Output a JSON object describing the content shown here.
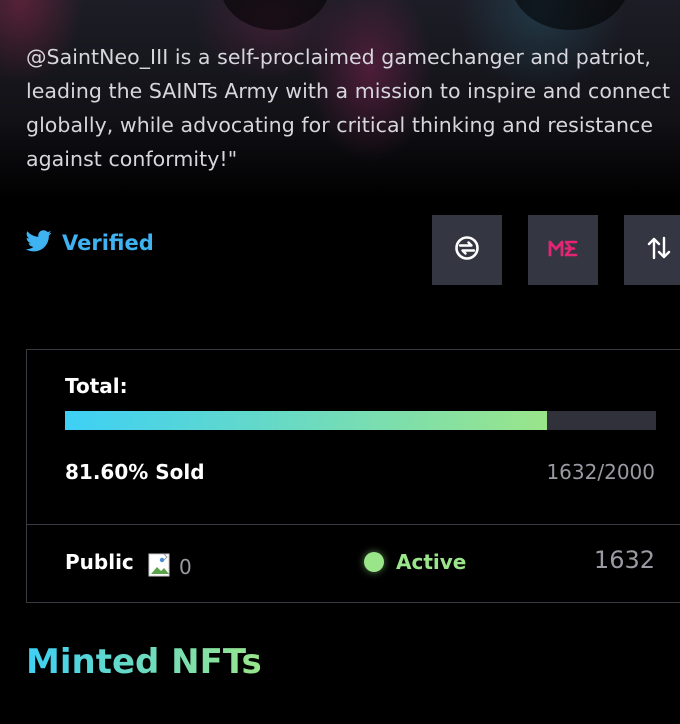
{
  "profile": {
    "description": "@SaintNeo_III is a self-proclaimed gamechanger and patriot, leading the SAINTs Army with a mission to inspire and connect globally, while advocating for critical thinking and resistance against conformity!\"",
    "verified_label": "Verified",
    "verified_icon": "twitter-bird-icon",
    "twitter_color": "#3fb2f2"
  },
  "actions": [
    {
      "icon": "sniper-icon"
    },
    {
      "icon": "magic-eden-icon",
      "color": "#e42575"
    },
    {
      "icon": "swap-arrows-icon"
    }
  ],
  "stats": {
    "total_label": "Total:",
    "progress_fraction": 0.816,
    "sold_label": "81.60% Sold",
    "sold_count": "1632/2000",
    "phase_label": "Public",
    "price_value": "0",
    "status_label": "Active",
    "minted_count": "1632",
    "accent_start": "#3ed0f5",
    "accent_end": "#9ae58a"
  },
  "section": {
    "title": "Minted NFTs"
  }
}
